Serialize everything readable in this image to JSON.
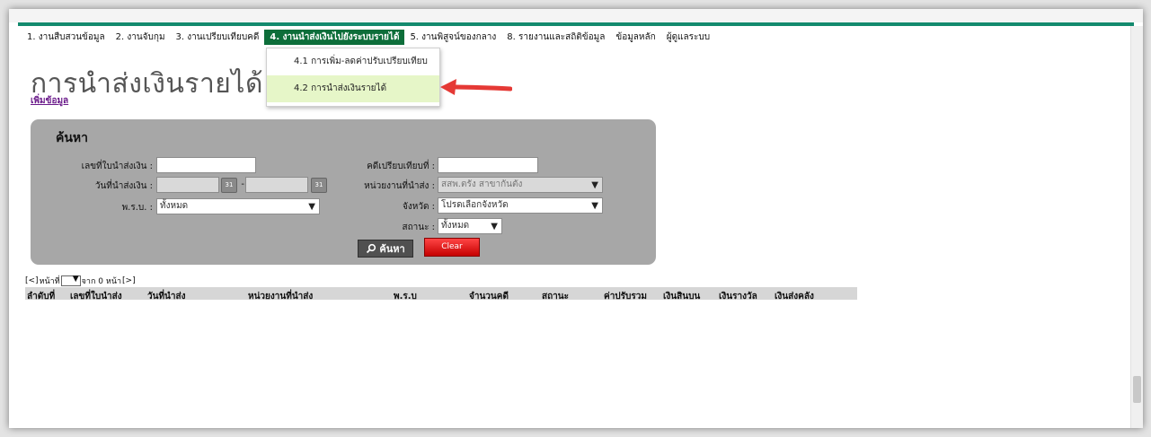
{
  "menu": {
    "items": [
      {
        "label": "1. งานสืบสวนข้อมูล"
      },
      {
        "label": "2. งานจับกุม"
      },
      {
        "label": "3. งานเปรียบเทียบคดี"
      },
      {
        "label": "4. งานนำส่งเงินไปยังระบบรายได้"
      },
      {
        "label": "5. งานพิสูจน์ของกลาง"
      },
      {
        "label": "8. รายงานและสถิติข้อมูล"
      },
      {
        "label": "ข้อมูลหลัก"
      },
      {
        "label": "ผู้ดูแลระบบ"
      }
    ],
    "active_index": 3,
    "dropdown": {
      "items": [
        {
          "label": "4.1 การเพิ่ม-ลดค่าปรับเปรียบเทียบ"
        },
        {
          "label": "4.2 การนำส่งเงินรายได้"
        }
      ],
      "highlighted_index": 1
    }
  },
  "page": {
    "title": "การนำส่งเงินรายได้",
    "add_link": "เพิ่มข้อมูล"
  },
  "search": {
    "title": "ค้นหา",
    "fields": {
      "slip_no_label": "เลขที่ใบนำส่งเงิน :",
      "slip_no_value": "",
      "date_label": "วันที่นำส่งเงิน :",
      "date_sep": "-",
      "act_label": "พ.ร.บ. :",
      "act_value": "ทั้งหมด",
      "case_no_label": "คดีเปรียบเทียบที่ :",
      "case_no_value": "",
      "unit_label": "หน่วยงานที่นำส่ง :",
      "unit_value": "สสพ.ตรัง สาขากันตัง",
      "province_label": "จังหวัด :",
      "province_value": "โปรดเลือกจังหวัด",
      "status_label": "สถานะ :",
      "status_value": "ทั้งหมด"
    },
    "search_button": "ค้นหา",
    "clear_button": "Clear"
  },
  "pager": {
    "prev": "[<]",
    "page_label": "หน้าที่",
    "total_text": "จาก 0 หน้า",
    "next": "[>]"
  },
  "table": {
    "columns": [
      "ลำดับที่",
      "เลขที่ใบนำส่ง",
      "วันที่นำส่ง",
      "หน่วยงานที่นำส่ง",
      "พ.ร.บ",
      "จำนวนคดี",
      "สถานะ",
      "ค่าปรับรวม",
      "เงินสินบน",
      "เงินรางวัล",
      "เงินส่งคลัง"
    ]
  },
  "colors": {
    "accent_green": "#0d6e3a",
    "menu_highlight": "#e6f6c8",
    "arrow_red": "#e53935",
    "panel_gray": "#a7a7a7"
  }
}
